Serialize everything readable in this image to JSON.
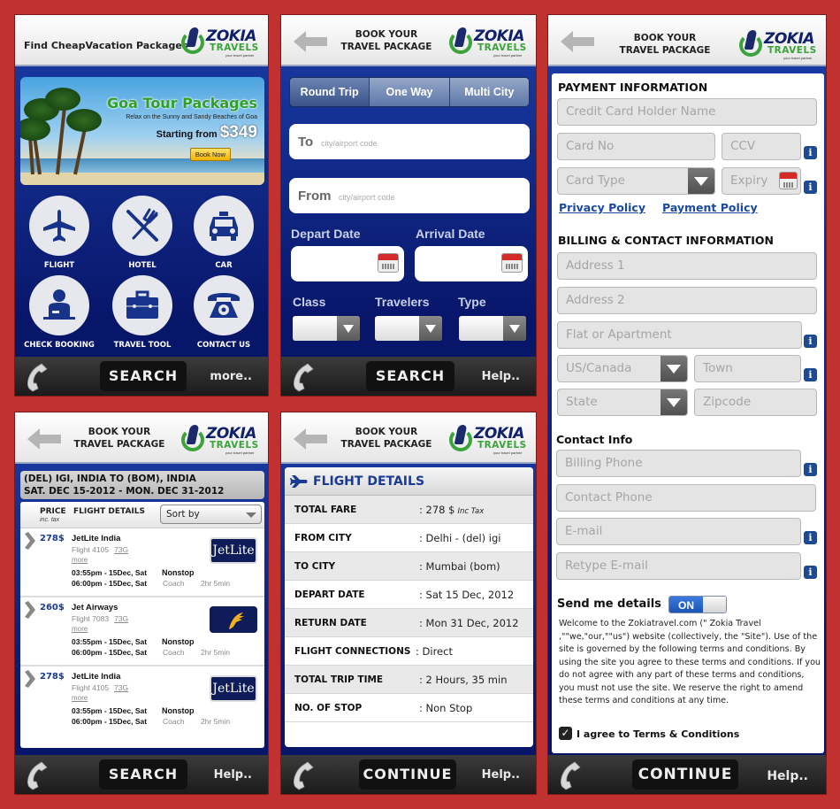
{
  "common": {
    "header_title_line1": "BOOK YOUR",
    "header_title_line2": "TRAVEL PACKAGE",
    "logo_name": "ZOKIA",
    "logo_sub": "TRAVELS",
    "logo_tagline": "your travel partner",
    "back_icon": "back-arrow-icon",
    "phone_icon": "phone-handset-icon",
    "colors": {
      "background": "#c0312f",
      "primary_blue": "#1a3a94",
      "logo_green": "#3aa33a",
      "footer": "#222222"
    }
  },
  "home": {
    "header_title": "Find CheapVacation Packages",
    "banner": {
      "title": "Goa Tour Packages",
      "subtitle": "Relax on the Sunny and Sandy Beaches of Goa",
      "starting_label": "Starting from",
      "price": "$349",
      "cta": "Book Now"
    },
    "menu": [
      {
        "label": "FLIGHT",
        "icon": "airplane-icon"
      },
      {
        "label": "HOTEL",
        "icon": "fork-knife-icon"
      },
      {
        "label": "CAR",
        "icon": "taxi-icon"
      },
      {
        "label": "CHECK BOOKING",
        "icon": "receptionist-icon"
      },
      {
        "label": "TRAVEL TOOL",
        "icon": "briefcase-icon"
      },
      {
        "label": "CONTACT US",
        "icon": "telephone-icon"
      }
    ],
    "footer": {
      "main_button": "SEARCH",
      "right_link": "more.."
    }
  },
  "search": {
    "trip_tabs": [
      {
        "label": "Round Trip",
        "selected": true
      },
      {
        "label": "One Way",
        "selected": false
      },
      {
        "label": "Multi City",
        "selected": false
      }
    ],
    "to": {
      "label": "To",
      "placeholder": "city/airport code",
      "value": ""
    },
    "from": {
      "label": "From",
      "placeholder": "city/airport code",
      "value": ""
    },
    "depart_label": "Depart Date",
    "arrival_label": "Arrival Date",
    "class_label": "Class",
    "travelers_label": "Travelers",
    "type_label": "Type",
    "footer": {
      "main_button": "SEARCH",
      "right_link": "Help.."
    }
  },
  "payment": {
    "payment_heading": "PAYMENT INFORMATION",
    "card_holder_placeholder": "Credit Card Holder Name",
    "card_no_placeholder": "Card No",
    "ccv_placeholder": "CCV",
    "card_type_placeholder": "Card Type",
    "expiry_placeholder": "Expiry",
    "privacy_link": "Privacy Policy",
    "payment_link": "Payment Policy",
    "billing_heading": "BILLING & CONTACT INFORMATION",
    "address1_placeholder": "Address 1",
    "address2_placeholder": "Address 2",
    "flat_placeholder": "Flat or Apartment",
    "country_value": "US/Canada",
    "town_placeholder": "Town",
    "state_value": "State",
    "zipcode_placeholder": "Zipcode",
    "contact_heading": "Contact Info",
    "billing_phone_placeholder": "Billing Phone",
    "contact_phone_placeholder": "Contact Phone",
    "email_placeholder": "E-mail",
    "retype_email_placeholder": "Retype E-mail",
    "send_details_label": "Send me details",
    "send_details_toggle": "ON",
    "terms_text": "Welcome to the Zokiatravel.com (\" Zokia Travel ,\"\"we,\"our,\"\"us\") website (collectively, the \"Site\"). Use of the site is governed by the following terms and conditions. By using the site you agree to these terms and conditions. If you do not agree with any part of these terms and conditions, you must not use the site. We reserve the right to amend these terms and conditions at any time.",
    "agree_label": "I agree to Terms & Conditions",
    "agree_checked": true,
    "footer": {
      "main_button": "CONTINUE",
      "right_link": "Help.."
    }
  },
  "results": {
    "route_line1": "(DEL) IGI, INDIA  TO (BOM), INDIA",
    "route_line2": "SAT. DEC 15-2012 - MON. DEC 31-2012",
    "col_price": "PRICE",
    "col_price_sub": "inc. tax",
    "col_details": "FLIGHT DETAILS",
    "sort_label": "Sort by",
    "flights": [
      {
        "price": "278$",
        "airline": "JetLite India",
        "flight": "Flight 4105",
        "aircraft": "73G",
        "more": "more",
        "depart": "03:55pm - 15Dec, Sat",
        "arrive": "06:00pm - 15Dec, Sat",
        "stops": "Nonstop",
        "cabin": "Coach",
        "duration": "2hr 5min",
        "logo": "JetLite"
      },
      {
        "price": "260$",
        "airline": "Jet Airways",
        "flight": "Flight 7083",
        "aircraft": "73G",
        "more": "more",
        "depart": "03:55pm - 15Dec, Sat",
        "arrive": "06:00pm - 15Dec, Sat",
        "stops": "Nonstop",
        "cabin": "Coach",
        "duration": "2hr 5min",
        "logo": ""
      },
      {
        "price": "278$",
        "airline": "JetLite India",
        "flight": "Flight 4105",
        "aircraft": "73G",
        "more": "more",
        "depart": "03:55pm - 15Dec, Sat",
        "arrive": "06:00pm - 15Dec, Sat",
        "stops": "Nonstop",
        "cabin": "Coach",
        "duration": "2hr 5min",
        "logo": "JetLite"
      }
    ],
    "footer": {
      "main_button": "SEARCH",
      "right_link": "Help.."
    }
  },
  "details": {
    "heading": "FLIGHT DETAILS",
    "rows": [
      {
        "key": "TOTAL FARE",
        "value": ": 278 $",
        "note": "Inc Tax"
      },
      {
        "key": "FROM CITY",
        "value": ": Delhi - (del) igi",
        "note": ""
      },
      {
        "key": "TO CITY",
        "value": ": Mumbai (bom)",
        "note": ""
      },
      {
        "key": "DEPART DATE",
        "value": ": Sat 15 Dec, 2012",
        "note": ""
      },
      {
        "key": "RETURN DATE",
        "value": ": Mon 31 Dec, 2012",
        "note": ""
      },
      {
        "key": "FLIGHT CONNECTIONS",
        "value": ": Direct",
        "note": ""
      },
      {
        "key": "TOTAL TRIP TIME",
        "value": ": 2 Hours, 35 min",
        "note": ""
      },
      {
        "key": "NO. OF STOP",
        "value": ": Non Stop",
        "note": ""
      }
    ],
    "footer": {
      "main_button": "CONTINUE",
      "right_link": "Help.."
    }
  }
}
